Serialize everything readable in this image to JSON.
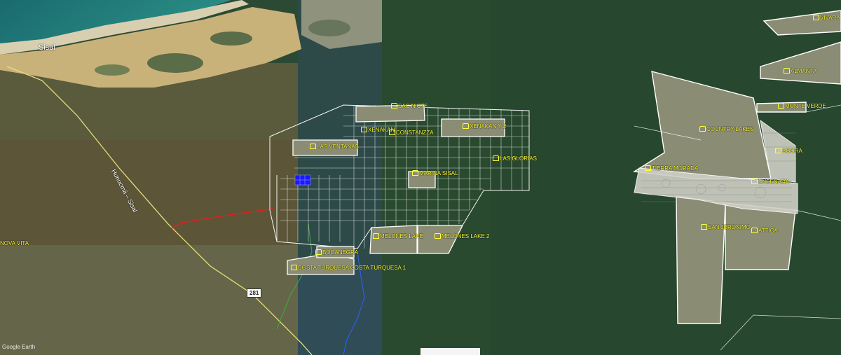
{
  "watermark": "Google Earth",
  "town": "Sisal",
  "road": "Hunucmá – Sisal",
  "highway_shield": "281",
  "colors": {
    "label": "#ffff3a",
    "boundary": "#ffffff",
    "red_road": "#e02020",
    "blue_plot": "#1a1aff",
    "parcel_fill": "#8a8c74"
  },
  "labels": {
    "sac_nicte": "SAC NICTE",
    "xenakan": "XENAKAN",
    "constanzza": "CONSTANZZA",
    "xenakan_2": "XENAKAN Y 2",
    "las_ventanas": "LAS VENTANAS",
    "las_glorias": "LAS GLORIAS",
    "marina_sisal": "MARINA SISAL",
    "bocanegra": "BOCANEGRA",
    "costa_turquesa": "COSTA TURQUESA COSTA TURQUESA 1",
    "melones_lake": "MELONES LAKE",
    "melones_lake_2": "MELONES LAKE 2",
    "nova_vita": "NOVA VITA",
    "vivara": "VIVARA",
    "almanta": "ALMANTA",
    "monte_verde": "MONTE VERDE",
    "country_lakes": "COUNTRY LAKES",
    "agora": "AGORA",
    "tierra_morada": "TIERRA MORADA",
    "ensenada": "ENSENADA",
    "san_jeronimo": "SAN JERONIMO",
    "attica": "ATTICA"
  }
}
